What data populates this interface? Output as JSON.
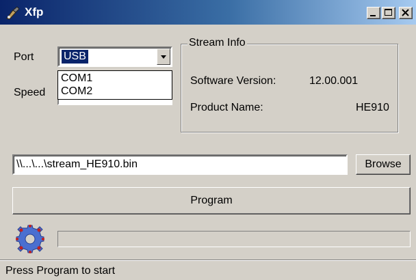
{
  "window": {
    "title": "Xfp"
  },
  "connection": {
    "port_label": "Port",
    "port_selected": "USB",
    "port_options": [
      "COM1",
      "COM2"
    ],
    "speed_label": "Speed"
  },
  "stream_info": {
    "legend": "Stream Info",
    "software_version_label": "Software Version:",
    "software_version_value": "12.00.001",
    "product_name_label": "Product Name:",
    "product_name_value": "HE910"
  },
  "file": {
    "path_value": "\\\\...\\...\\stream_HE910.bin",
    "browse_label": "Browse"
  },
  "actions": {
    "program_label": "Program"
  },
  "progress": {
    "value": 0
  },
  "status": {
    "text": "Press Program to start"
  },
  "icons": {
    "app": "xfp-app-icon",
    "minimize": "minimize-icon",
    "maximize": "maximize-icon",
    "close": "close-icon",
    "dropdown": "chevron-down-icon",
    "logo": "puzzle-gear-icon"
  }
}
